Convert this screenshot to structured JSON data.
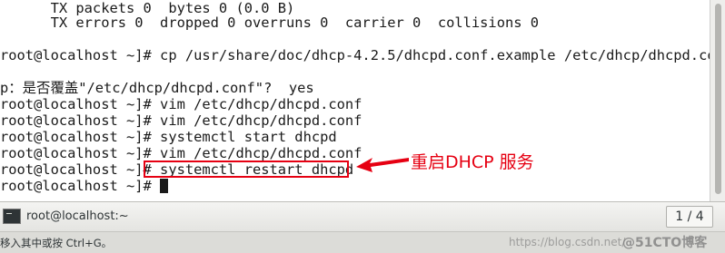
{
  "terminal": {
    "lines": [
      "      TX packets 0  bytes 0 (0.0 B)",
      "      TX errors 0  dropped 0 overruns 0  carrier 0  collisions 0",
      "",
      "root@localhost ~]# cp /usr/share/doc/dhcp-4.2.5/dhcpd.conf.example /etc/dhcp/dhcpd.con",
      "",
      "p：是否覆盖\"/etc/dhcp/dhcpd.conf\"?  yes",
      "root@localhost ~]# vim /etc/dhcp/dhcpd.conf",
      "root@localhost ~]# vim /etc/dhcp/dhcpd.conf",
      "root@localhost ~]# systemctl start dhcpd",
      "root@localhost ~]# vim /etc/dhcp/dhcpd.conf",
      "root@localhost ~]# systemctl restart dhcpd",
      "root@localhost ~]# "
    ]
  },
  "annotation": {
    "text": "重启DHCP 服务",
    "color": "#e60012"
  },
  "taskbar": {
    "window_title": "root@localhost:~",
    "icon": "terminal-icon",
    "pager": "1 / 4"
  },
  "statusbar": {
    "hint": "移入其中或按 Ctrl+G。"
  },
  "watermark": {
    "text": "https://blog.csdn.net/",
    "logo": "@51CTO博客"
  }
}
